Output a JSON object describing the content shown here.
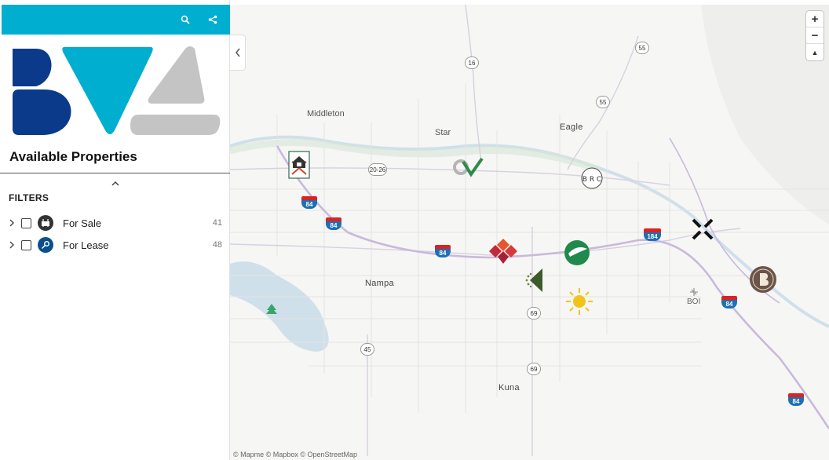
{
  "header": {
    "search_icon": "search-icon",
    "share_icon": "share-icon",
    "bg_color": "#00aecf"
  },
  "sidebar": {
    "title": "Available Properties",
    "filters_heading": "FILTERS",
    "filters": [
      {
        "label": "For Sale",
        "count": "41",
        "icon": "for-sale-sign-icon",
        "checked": false
      },
      {
        "label": "For Lease",
        "count": "48",
        "icon": "for-lease-key-icon",
        "checked": false
      }
    ]
  },
  "brand": {
    "dark_blue": "#0b3a8a",
    "cyan": "#00aecf",
    "gray": "#c4c4c4"
  },
  "map": {
    "places": {
      "middleton": "Middleton",
      "star": "Star",
      "eagle": "Eagle",
      "nampa": "Nampa",
      "kuna": "Kuna",
      "boi": "BOI"
    },
    "routes": {
      "r16": "16",
      "r55a": "55",
      "r55b": "55",
      "r20_26": "20-26",
      "i84a": "84",
      "i84b": "84",
      "i84c": "84",
      "i84d": "84",
      "i84e": "84",
      "i184": "184",
      "r69a": "69",
      "r69b": "69",
      "r45": "45"
    },
    "marker_text": {
      "brc": "B R C"
    },
    "zoom": {
      "in": "+",
      "out": "−",
      "reset": "▲"
    },
    "attribution": [
      "© Mapme",
      "© Mapbox",
      "© OpenStreetMap"
    ]
  }
}
